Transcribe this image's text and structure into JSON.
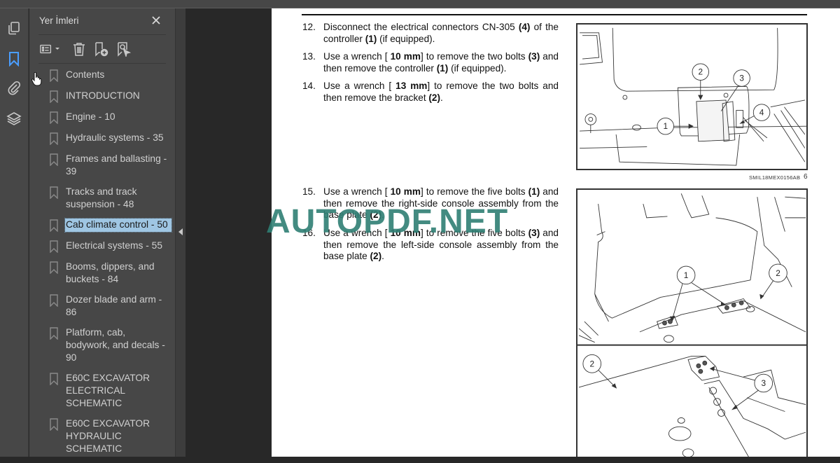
{
  "app": {
    "accent_color": "#4a9eff",
    "selected_bookmark_color": "#9fc6e3"
  },
  "left_rail": {
    "items": [
      {
        "name": "pages",
        "icon": "page-thumbnails-icon",
        "active": false
      },
      {
        "name": "bookmarks",
        "icon": "bookmark-icon",
        "active": true
      },
      {
        "name": "attachments",
        "icon": "paperclip-icon",
        "active": false
      },
      {
        "name": "layers",
        "icon": "layers-icon",
        "active": false
      }
    ]
  },
  "bookmarks_panel": {
    "title": "Yer İmleri",
    "close_label": "✕",
    "toolbar": [
      {
        "name": "options",
        "icon": "list-options-icon"
      },
      {
        "name": "delete",
        "icon": "trash-icon"
      },
      {
        "name": "new-bookmark",
        "icon": "add-bookmark-icon"
      },
      {
        "name": "find-current",
        "icon": "find-bookmark-icon"
      }
    ],
    "items": [
      {
        "label": "Contents",
        "selected": false
      },
      {
        "label": "INTRODUCTION",
        "selected": false
      },
      {
        "label": "Engine - 10",
        "selected": false
      },
      {
        "label": "Hydraulic systems - 35",
        "selected": false
      },
      {
        "label": "Frames and ballasting - 39",
        "selected": false
      },
      {
        "label": "Tracks and track suspension - 48",
        "selected": false
      },
      {
        "label": "Cab climate control - 50",
        "selected": true
      },
      {
        "label": "Electrical systems - 55",
        "selected": false
      },
      {
        "label": "Booms, dippers, and buckets - 84",
        "selected": false
      },
      {
        "label": "Dozer blade and arm - 86",
        "selected": false
      },
      {
        "label": "Platform, cab, bodywork, and decals - 90",
        "selected": false
      },
      {
        "label": "E60C EXCAVATOR ELECTRICAL SCHEMATIC",
        "selected": false
      },
      {
        "label": "E60C EXCAVATOR HYDRAULIC SCHEMATIC",
        "selected": false
      }
    ]
  },
  "document": {
    "steps": [
      {
        "num": "12.",
        "parts": [
          [
            "t",
            "Disconnect the electrical connectors CN-305 "
          ],
          [
            "b",
            "(4)"
          ],
          [
            "t",
            " of the controller "
          ],
          [
            "b",
            "(1)"
          ],
          [
            "t",
            " (if equipped)."
          ]
        ]
      },
      {
        "num": "13.",
        "parts": [
          [
            "t",
            "Use a wrench [ "
          ],
          [
            "b",
            "10 mm"
          ],
          [
            "t",
            "] to remove the two bolts "
          ],
          [
            "b",
            "(3)"
          ],
          [
            "t",
            " and then remove the controller "
          ],
          [
            "b",
            "(1)"
          ],
          [
            "t",
            " (if equipped)."
          ]
        ]
      },
      {
        "num": "14.",
        "parts": [
          [
            "t",
            "Use a wrench [ "
          ],
          [
            "b",
            "13 mm"
          ],
          [
            "t",
            "] to remove the two bolts and then remove the bracket "
          ],
          [
            "b",
            "(2)"
          ],
          [
            "t",
            "."
          ]
        ]
      },
      {
        "num": "15.",
        "parts": [
          [
            "t",
            "Use a wrench [ "
          ],
          [
            "b",
            "10 mm"
          ],
          [
            "t",
            "] to remove the five bolts "
          ],
          [
            "b",
            "(1)"
          ],
          [
            "t",
            " and then remove the right-side console assembly from the base plate "
          ],
          [
            "b",
            "(2)"
          ],
          [
            "t",
            "."
          ]
        ]
      },
      {
        "num": "16.",
        "parts": [
          [
            "t",
            "Use a wrench [ "
          ],
          [
            "b",
            "10 mm"
          ],
          [
            "t",
            "] to remove the five bolts "
          ],
          [
            "b",
            "(3)"
          ],
          [
            "t",
            " and then remove the left-side console assembly from the base plate "
          ],
          [
            "b",
            "(2)"
          ],
          [
            "t",
            "."
          ]
        ]
      }
    ],
    "figure1": {
      "callouts": [
        "1",
        "2",
        "3",
        "4"
      ],
      "caption": "SMIL18MEX0156AB",
      "number": "6"
    },
    "figure2": {
      "callouts_top": [
        "1",
        "2"
      ],
      "callouts_bottom": [
        "2",
        "3"
      ]
    },
    "watermark": "AUTOPDF.NET"
  }
}
